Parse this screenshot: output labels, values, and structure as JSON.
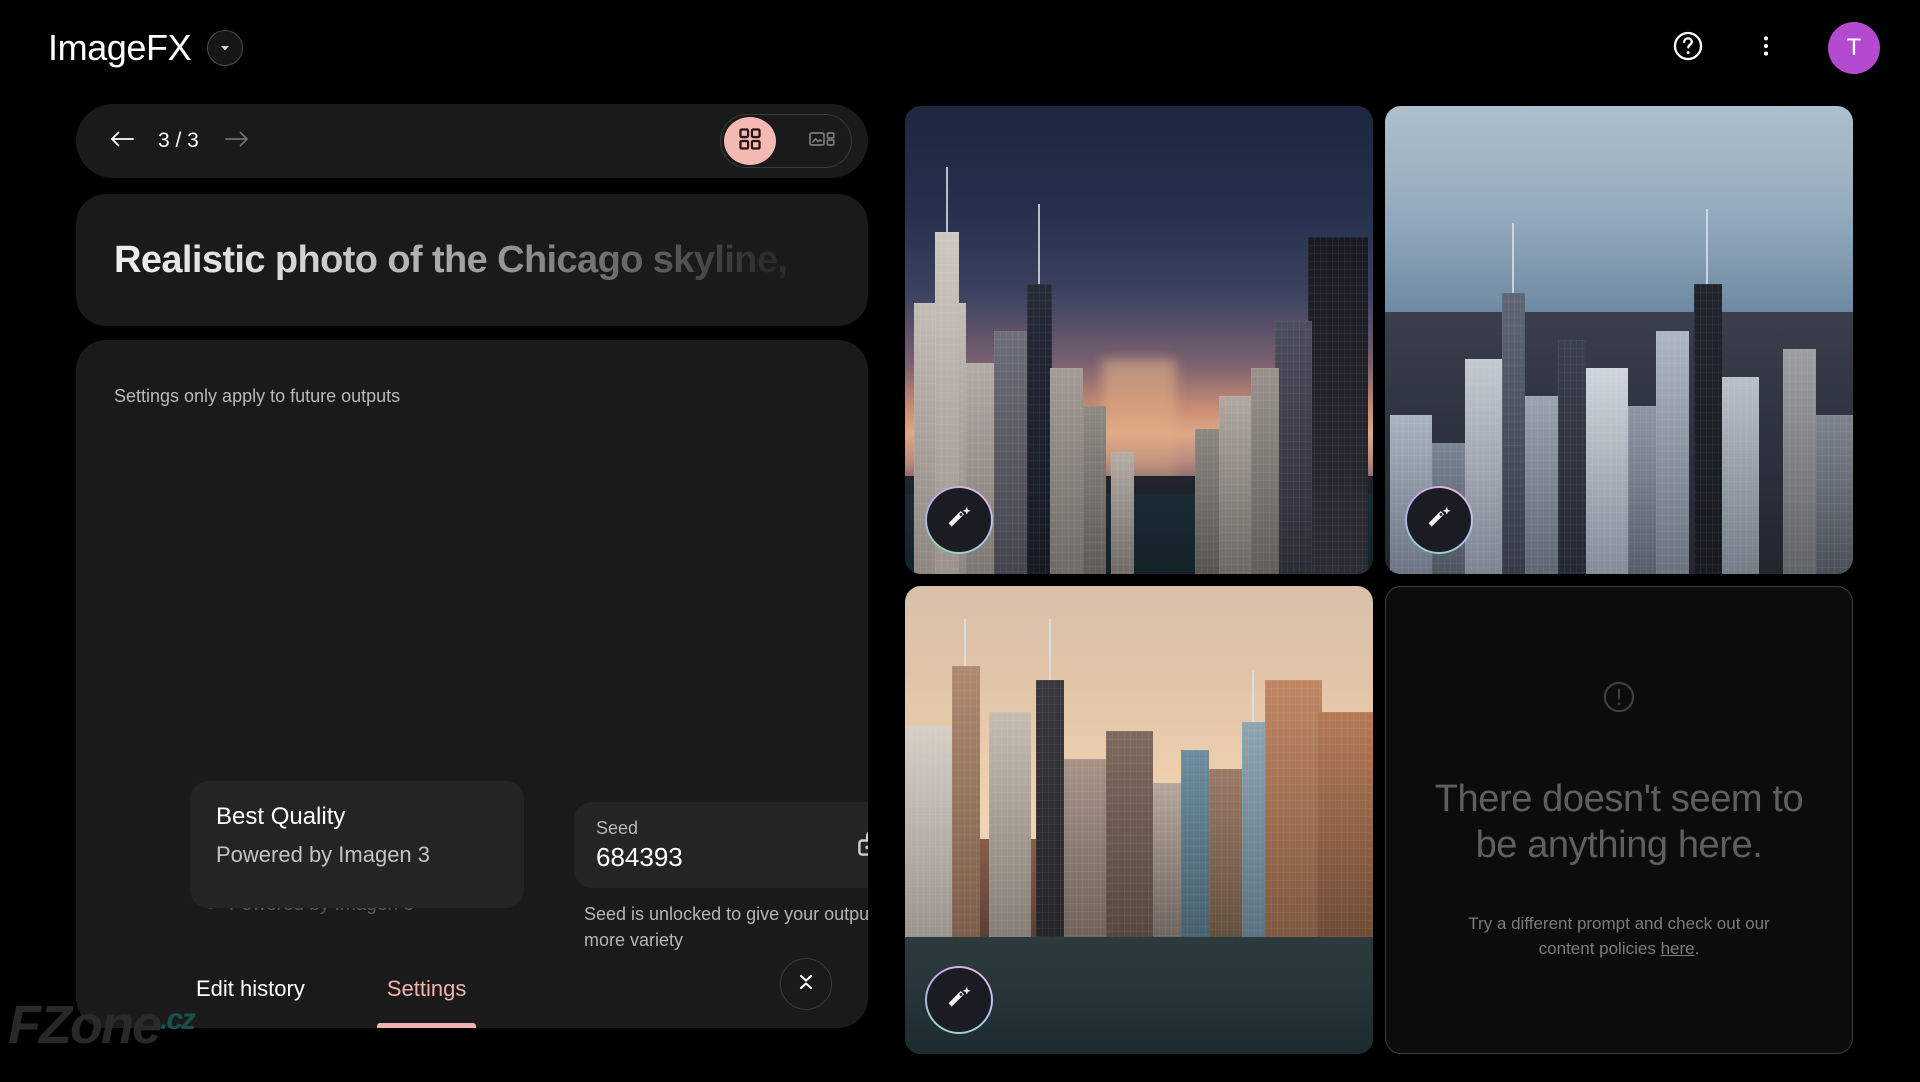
{
  "app": {
    "title": "ImageFX",
    "brand_caret_icon": "chevron-down-icon"
  },
  "topbar": {
    "help_icon": "help-circle-icon",
    "more_icon": "more-vertical-icon",
    "avatar_initial": "T",
    "avatar_color": "#b44ad0"
  },
  "nav": {
    "prev_icon": "arrow-left-icon",
    "next_icon": "arrow-right-icon",
    "counter": "3 / 3",
    "view_toggle": {
      "grid_icon": "grid-view-icon",
      "grid_active": true,
      "list_icon": "image-list-view-icon",
      "list_active": false
    }
  },
  "prompt": {
    "text": "Realistic photo of the Chicago skyline,"
  },
  "settings": {
    "note": "Settings only apply to future outputs",
    "ghost_note": "Powered by Imagen 3",
    "ghost_icon": "info-icon",
    "quality": {
      "title": "Best Quality",
      "subtitle": "Powered by Imagen 3"
    },
    "seed": {
      "label": "Seed",
      "value": "684393",
      "lock_icon": "lock-open-icon",
      "help": "Seed is unlocked to give your outputs more variety"
    }
  },
  "tabs": {
    "edit_history": "Edit history",
    "settings": "Settings",
    "active": "Settings",
    "collapse_icon": "unfold-less-icon"
  },
  "gallery": {
    "edit_icon": "magic-wand-edit-icon",
    "items": [
      {
        "alt": "Chicago skyline at dusk looking down Michigan Avenue toward the river"
      },
      {
        "alt": "Aerial blue-hour view of Chicago skyline with Lake Michigan"
      },
      {
        "alt": "Golden-hour photo of Chicago skyline along the Chicago River"
      }
    ]
  },
  "empty_state": {
    "icon": "exclamation-circle-icon",
    "title": "There doesn't seem to be anything here.",
    "subtitle_before": "Try a different prompt and check out our content policies ",
    "link": "here",
    "subtitle_after": "."
  },
  "watermark": {
    "name": "FZone",
    "tld": ".cz"
  },
  "accent_color": "#f0b3ad"
}
